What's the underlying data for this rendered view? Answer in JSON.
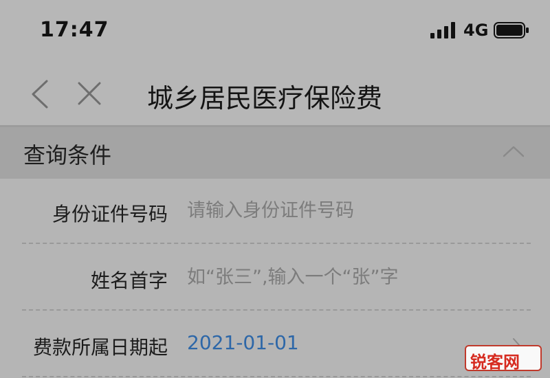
{
  "status_bar": {
    "time": "17:47",
    "network": "4G",
    "signal_icon": "signal-bars-icon",
    "battery_icon": "battery-icon"
  },
  "nav_bar": {
    "title": "城乡居民医疗保险费",
    "back_icon": "chevron-left-icon",
    "close_icon": "close-icon"
  },
  "section": {
    "title": "查询条件",
    "toggle_icon": "chevron-up-icon"
  },
  "form": {
    "id_number": {
      "label": "身份证件号码",
      "placeholder": "请输入身份证件号码",
      "value": ""
    },
    "surname": {
      "label": "姓名首字",
      "placeholder": "如“张三”,输入一个“张”字",
      "value": ""
    },
    "start_date": {
      "label": "费款所属日期起",
      "value": "2021-01-01",
      "icon": "chevron-right-icon"
    }
  },
  "watermark": {
    "text": "锐客网"
  },
  "colors": {
    "background": "#b5b5b5",
    "section_header": "#a4a4a4",
    "accent_value": "#2d67a8",
    "placeholder": "#7c7c7c",
    "watermark": "#d62a1f"
  }
}
